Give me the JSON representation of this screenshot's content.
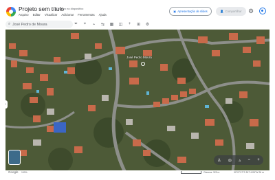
{
  "app": {
    "title": "Projeto sem título",
    "saved_status": "Salvo no dispositivo",
    "menu": [
      "Arquivo",
      "Editar",
      "Visualizar",
      "Adicionar",
      "Ferramentas",
      "Ajuda"
    ]
  },
  "header": {
    "present_label": "Apresentação de slides",
    "share_label": "Compartilhar"
  },
  "search": {
    "value": "José Pedro de Moura"
  },
  "toolbar_icons": [
    "filter-icon",
    "add-location-icon",
    "add-path-icon",
    "measure-icon",
    "layers-icon",
    "map-style-icon",
    "plus-icon",
    "slides-icon",
    "settings-icon"
  ],
  "map": {
    "place_label": "José Pedro Moura"
  },
  "footer": {
    "brand": "Google",
    "zoom_pct": "100%",
    "camera": "Câmera: 329 m",
    "coords": "30°07'47\"S 51°14'05\"W  26 m"
  },
  "colors": {
    "accent": "#1a73e8",
    "roof": "#c86a4a",
    "foliage": "#4d5a37"
  }
}
